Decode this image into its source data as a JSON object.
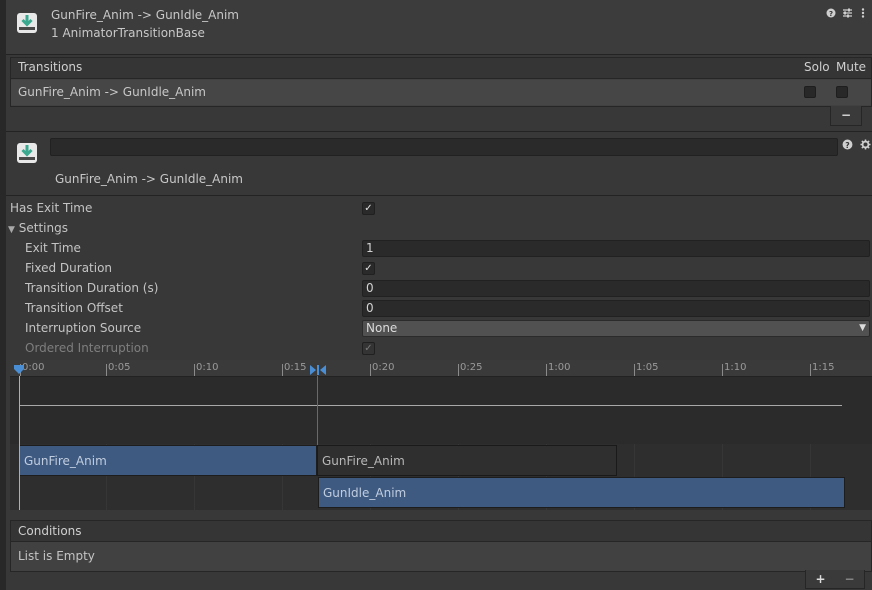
{
  "header": {
    "title": "GunFire_Anim -> GunIdle_Anim",
    "subtitle": "1 AnimatorTransitionBase",
    "icons": [
      "help-icon",
      "preset-icon",
      "more-icon"
    ]
  },
  "transitions": {
    "heading": "Transitions",
    "solo_label": "Solo",
    "mute_label": "Mute",
    "rows": [
      {
        "label": "GunFire_Anim -> GunIdle_Anim",
        "solo": false,
        "mute": false
      }
    ],
    "remove_label": "−"
  },
  "transition_detail": {
    "name_value": "",
    "label": "GunFire_Anim -> GunIdle_Anim"
  },
  "properties": {
    "has_exit_time_label": "Has Exit Time",
    "has_exit_time": true,
    "settings_label": "Settings",
    "exit_time_label": "Exit Time",
    "exit_time_value": "1",
    "fixed_duration_label": "Fixed Duration",
    "fixed_duration": true,
    "transition_duration_label": "Transition Duration (s)",
    "transition_duration_value": "0",
    "transition_offset_label": "Transition Offset",
    "transition_offset_value": "0",
    "interruption_source_label": "Interruption Source",
    "interruption_source_value": "None",
    "ordered_interruption_label": "Ordered Interruption",
    "ordered_interruption": true
  },
  "timeline": {
    "ticks": [
      "0:00",
      "0:05",
      "0:10",
      "0:15",
      "0:20",
      "0:25",
      "1:00",
      "1:05",
      "1:10",
      "1:15"
    ],
    "clips": {
      "source_top": "GunFire_Anim",
      "source_overlap": "GunFire_Anim",
      "destination": "GunIdle_Anim"
    }
  },
  "conditions": {
    "heading": "Conditions",
    "empty_text": "List is Empty",
    "add_label": "+",
    "remove_label": "−"
  },
  "colors": {
    "accent_blue": "#3f5a80",
    "cursor_blue": "#4a8fd6",
    "icon_teal": "#5cc8b0"
  }
}
